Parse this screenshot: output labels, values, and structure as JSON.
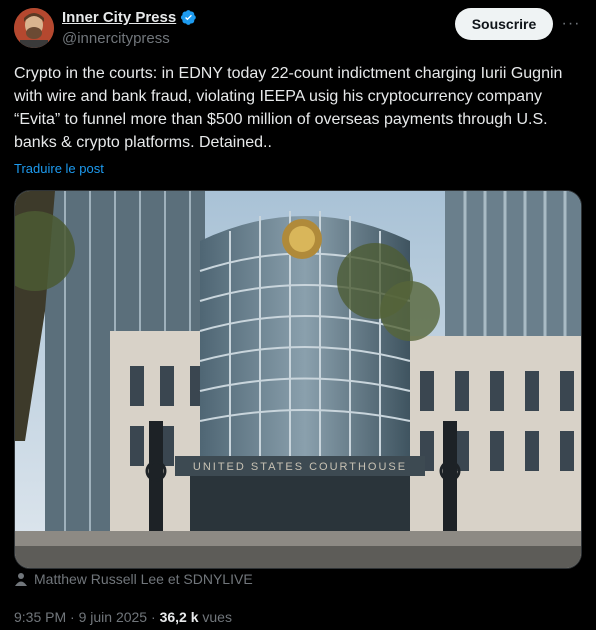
{
  "author": {
    "name": "Inner City Press",
    "handle": "@innercitypress",
    "avatar_icon": "avatar-photo"
  },
  "header": {
    "subscribe_label": "Souscrire",
    "more_icon": "ellipsis-icon"
  },
  "post": {
    "text": "Crypto in the courts: in EDNY today 22-count indictment charging Iurii Gugnin with wire and bank fraud, violating IEEPA usig his cryptocurrency company “Evita” to funnel more than $500 million of overseas payments through U.S. banks & crypto platforms. Detained..",
    "translate_label": "Traduire le post",
    "image": {
      "facade_text": "UNITED STATES COURTHOUSE"
    },
    "credit": "Matthew Russell Lee et SDNYLIVE",
    "time": "9:35 PM",
    "date": "9 juin 2025",
    "views_count": "36,2 k",
    "views_label": "vues"
  },
  "colors": {
    "accent": "#1d9bf0",
    "background": "#000000",
    "secondary_text": "#71767b"
  }
}
